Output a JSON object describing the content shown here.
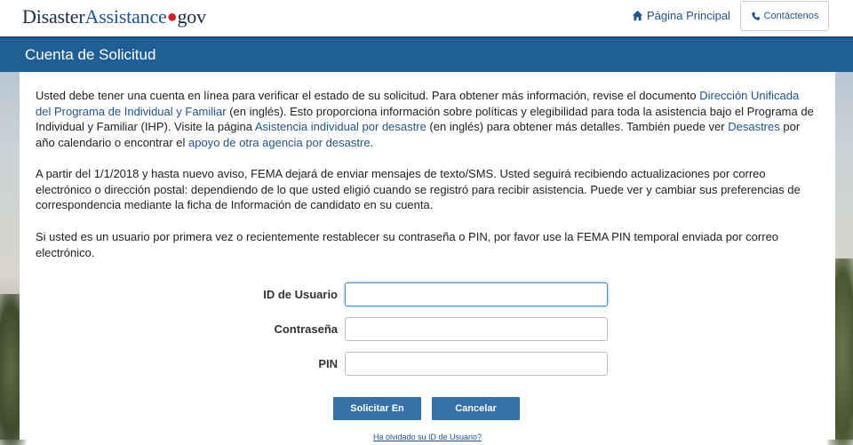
{
  "header": {
    "logo_part1": "Disaster",
    "logo_part2": "Assistance",
    "logo_dot": "●",
    "logo_part3": "gov",
    "home_label": "Página Principal",
    "home_icon": "home-icon",
    "contact_label": "Contáctenos",
    "contact_icon": "phone-icon"
  },
  "title": "Cuenta de Solicitud",
  "content": {
    "p1": {
      "t1": "Usted debe tener una cuenta en línea para verificar el estado de su solicitud. Para obtener más información, revise el documento ",
      "link1": "Dirección Unificada del Programa de Individual y Familiar",
      "t2": " (en inglés). Esto proporciona información sobre políticas y elegibilidad para toda la asistencia bajo el Programa de Individual y Familiar (IHP). Visite la página ",
      "link2": "Asistencia individual por desastre",
      "t3": " (en inglés) para obtener más detalles. También puede ver ",
      "link3": "Desastres",
      "t4": " por año calendario o encontrar el ",
      "link4": "apoyo de otra agencia por desastre",
      "t5": "."
    },
    "p2": "A partir del 1/1/2018 y hasta nuevo aviso, FEMA dejará de enviar mensajes de texto/SMS. Usted seguirá recibiendo actualizaciones por correo electrónico o dirección postal: dependiendo de lo que usted eligió cuando se registró para recibir asistencia. Puede ver y cambiar sus preferencias de correspondencia mediante la ficha de Información de candidato en su cuenta.",
    "p3": "Si usted es un usuario por primera vez o recientemente restablecer su contraseña o PIN, por favor use la FEMA PIN temporal enviada por correo electrónico."
  },
  "form": {
    "user_id_label": "ID de Usuario",
    "user_id_value": "",
    "password_label": "Contraseña",
    "password_value": "",
    "pin_label": "PIN",
    "pin_value": "",
    "submit_label": "Solicitar En",
    "cancel_label": "Cancelar",
    "forgot_label": "Ha olvidado su ID de Usuario?"
  },
  "colors": {
    "brand_blue": "#205493",
    "title_band": "#1f5f94",
    "button": "#3670a6",
    "logo_dot": "#d01f2a"
  }
}
